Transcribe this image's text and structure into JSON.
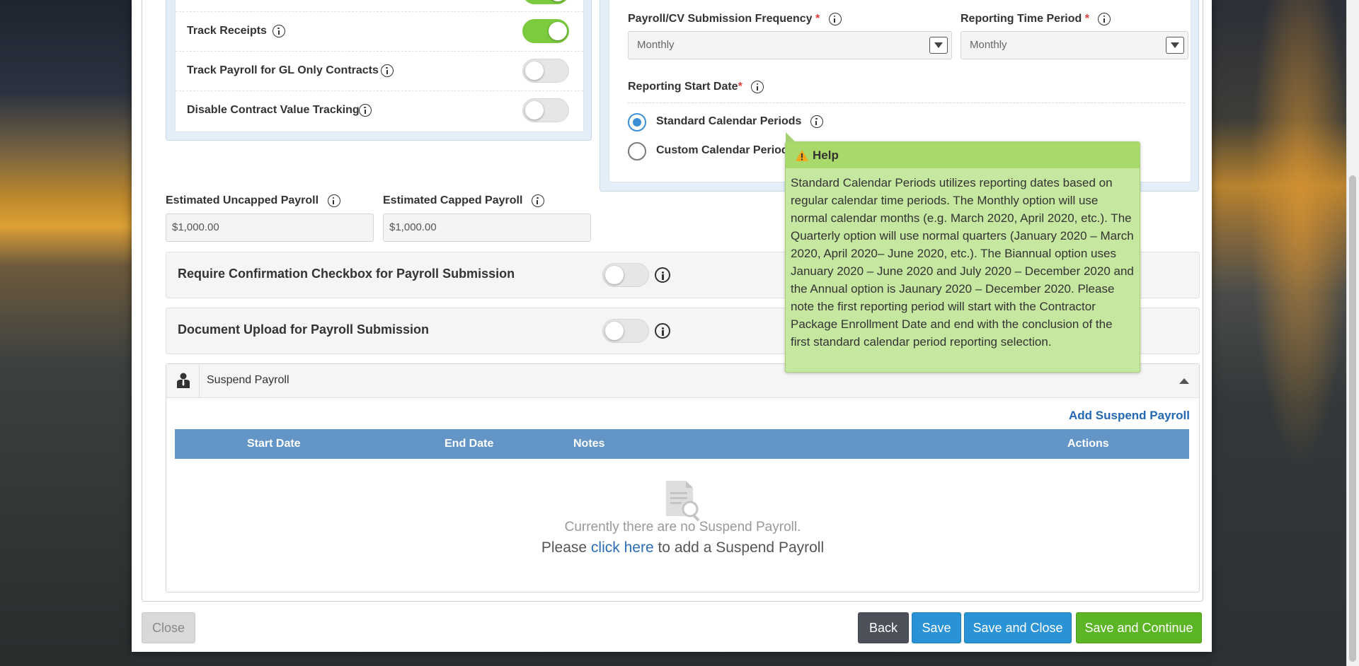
{
  "settings": {
    "track_receipts": "Track Receipts",
    "track_payroll_gl": "Track Payroll for GL Only Contracts",
    "disable_contract_value": "Disable Contract Value Tracking"
  },
  "reporting": {
    "frequency_label": "Payroll/CV Submission Frequency",
    "frequency_value": "Monthly",
    "time_period_label": "Reporting Time Period",
    "time_period_value": "Monthly",
    "start_date_label": "Reporting Start Date",
    "required_mark": "*",
    "standard_label": "Standard Calendar Periods",
    "custom_label": "Custom Calendar Periods"
  },
  "payroll": {
    "uncapped_label": "Estimated Uncapped Payroll",
    "uncapped_value": "$1,000.00",
    "capped_label": "Estimated Capped Payroll",
    "capped_value": "$1,000.00"
  },
  "options": {
    "confirmation_label": "Require Confirmation Checkbox for Payroll Submission",
    "document_upload_label": "Document Upload for Payroll Submission"
  },
  "suspend": {
    "title": "Suspend Payroll",
    "add_link": "Add Suspend Payroll",
    "columns": [
      "Start Date",
      "End Date",
      "Notes",
      "Actions"
    ],
    "empty_message": "Currently there are no Suspend Payroll.",
    "cta_prefix": "Please",
    "cta_link": "click here",
    "cta_suffix": "to add a Suspend Payroll"
  },
  "tooltip": {
    "title": "Help",
    "body": "Standard Calendar Periods utilizes reporting dates based on regular calendar time periods. The Monthly option will use normal calendar months (e.g. March 2020, April 2020, etc.). The Quarterly option will use normal quarters (January 2020 – March 2020, April 2020– June 2020, etc.). The Biannual option uses January 2020 – June 2020 and July 2020 – December 2020 and the Annual option is Jaunary 2020 – December 2020. Please note the first reporting period will start with the Contractor Package Enrollment Date and end with the conclusion of the first standard calendar period reporting selection."
  },
  "footer": {
    "close": "Close",
    "back": "Back",
    "save": "Save",
    "save_close": "Save and Close",
    "save_continue": "Save and Continue"
  },
  "colors": {
    "toggle_on": "#7ccb3f",
    "table_header": "#6495c7",
    "primary": "#2a93d5",
    "success": "#5cb524",
    "dark": "#4c5059",
    "tooltip_bg": "#c6e7a0"
  }
}
